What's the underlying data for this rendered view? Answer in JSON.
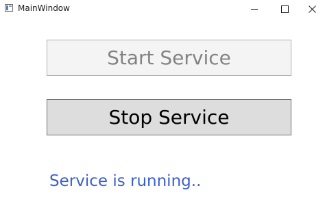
{
  "window": {
    "title": "MainWindow",
    "icon": "app-window-icon"
  },
  "caption_buttons": {
    "minimize_icon": "minimize-icon",
    "maximize_icon": "maximize-icon",
    "close_icon": "close-icon"
  },
  "main": {
    "start_label": "Start Service",
    "start_enabled": false,
    "stop_label": "Stop Service",
    "stop_enabled": true,
    "status_text": "Service is running.."
  },
  "colors": {
    "status_text": "#3b5fd0",
    "disabled_text": "#838383",
    "button_face": "#dddddd",
    "disabled_face": "#f4f4f4"
  }
}
